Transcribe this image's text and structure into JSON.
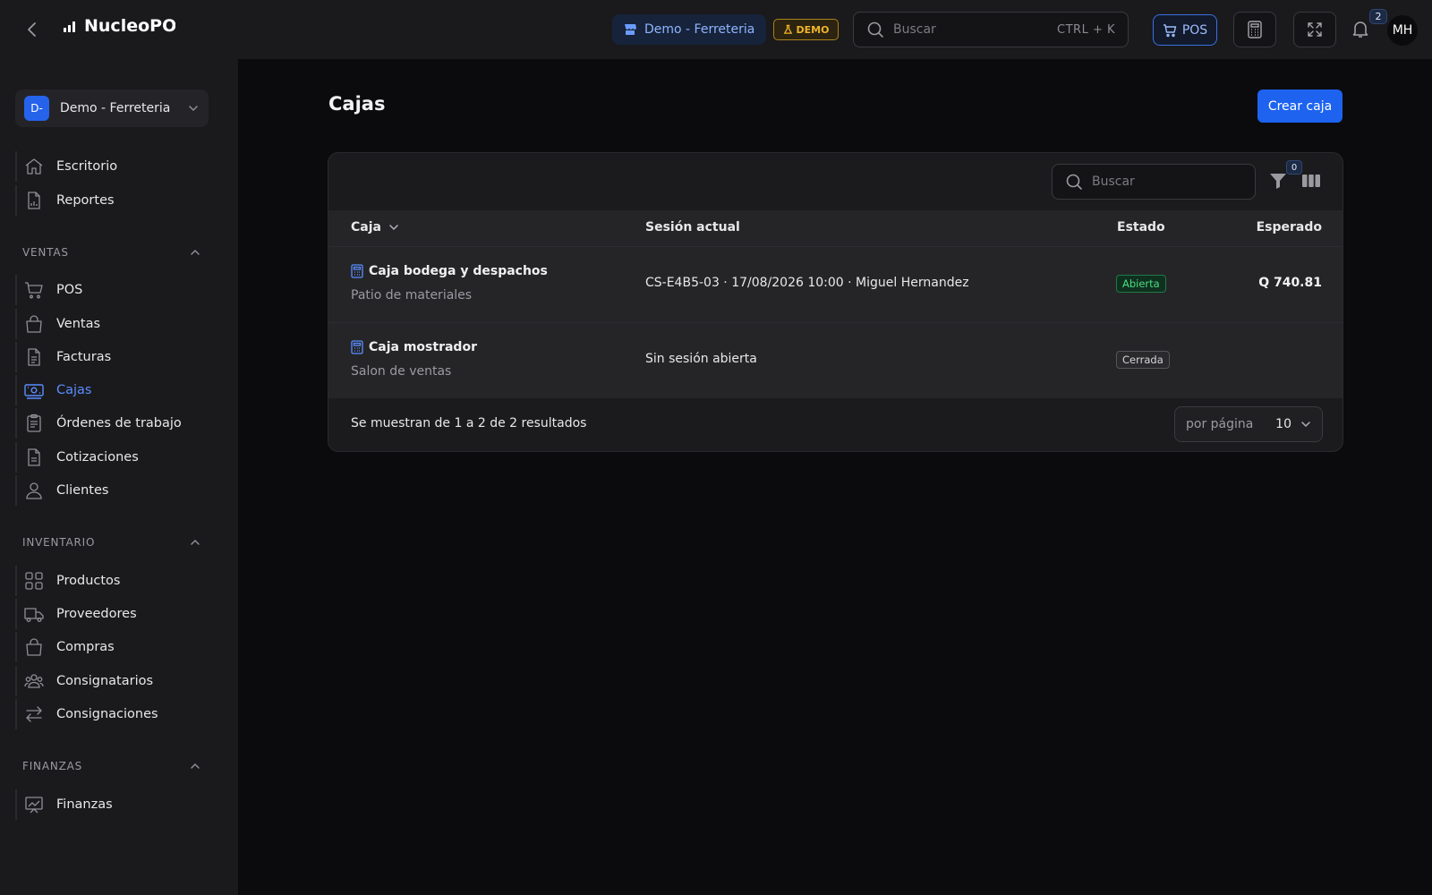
{
  "header": {
    "app_name": "NucleoPOS",
    "store_chip": "Demo - Ferreteria",
    "demo_badge": "DEMO",
    "search_placeholder": "Buscar",
    "search_shortcut": "CTRL + K",
    "pos_label": "POS",
    "notifications_count": "2",
    "user_initials": "MH"
  },
  "sidebar": {
    "store_initial": "D-",
    "store_name": "Demo - Ferreteria",
    "top_items": [
      {
        "label": "Escritorio",
        "icon": "home-icon"
      },
      {
        "label": "Reportes",
        "icon": "report-icon"
      }
    ],
    "sections": [
      {
        "title": "VENTAS",
        "items": [
          {
            "label": "POS",
            "icon": "cart-icon"
          },
          {
            "label": "Ventas",
            "icon": "bag-icon"
          },
          {
            "label": "Facturas",
            "icon": "invoice-icon"
          },
          {
            "label": "Cajas",
            "icon": "cash-register-icon",
            "active": true
          },
          {
            "label": "Órdenes de trabajo",
            "icon": "clipboard-icon"
          },
          {
            "label": "Cotizaciones",
            "icon": "quote-icon"
          },
          {
            "label": "Clientes",
            "icon": "user-icon"
          }
        ]
      },
      {
        "title": "INVENTARIO",
        "items": [
          {
            "label": "Productos",
            "icon": "grid-icon"
          },
          {
            "label": "Proveedores",
            "icon": "truck-icon"
          },
          {
            "label": "Compras",
            "icon": "bag-icon"
          },
          {
            "label": "Consignatarios",
            "icon": "users-icon"
          },
          {
            "label": "Consignaciones",
            "icon": "arrows-icon"
          }
        ]
      },
      {
        "title": "FINANZAS",
        "items": [
          {
            "label": "Finanzas",
            "icon": "chart-icon"
          }
        ]
      }
    ]
  },
  "main": {
    "title": "Cajas",
    "create_button": "Crear caja",
    "table_search_placeholder": "Buscar",
    "filter_count": "0",
    "columns": {
      "name": "Caja",
      "session": "Sesión actual",
      "status": "Estado",
      "expected": "Esperado"
    },
    "rows": [
      {
        "name": "Caja bodega y despachos",
        "location": "Patio de materiales",
        "session": "CS-E4B5-03 · 17/08/2026 10:00 · Miguel Hernandez",
        "status": "Abierta",
        "expected": "Q 740.81"
      },
      {
        "name": "Caja mostrador",
        "location": "Salon de ventas",
        "session": "Sin sesión abierta",
        "status": "Cerrada",
        "expected": ""
      }
    ],
    "results_text": "Se muestran de 1 a 2 de 2 resultados",
    "per_page_label": "por página",
    "per_page_value": "10"
  },
  "colors": {
    "accent": "#1d63f0",
    "active_nav": "#5b8dff",
    "status_open": "#4ade80",
    "demo": "#f0b429"
  }
}
